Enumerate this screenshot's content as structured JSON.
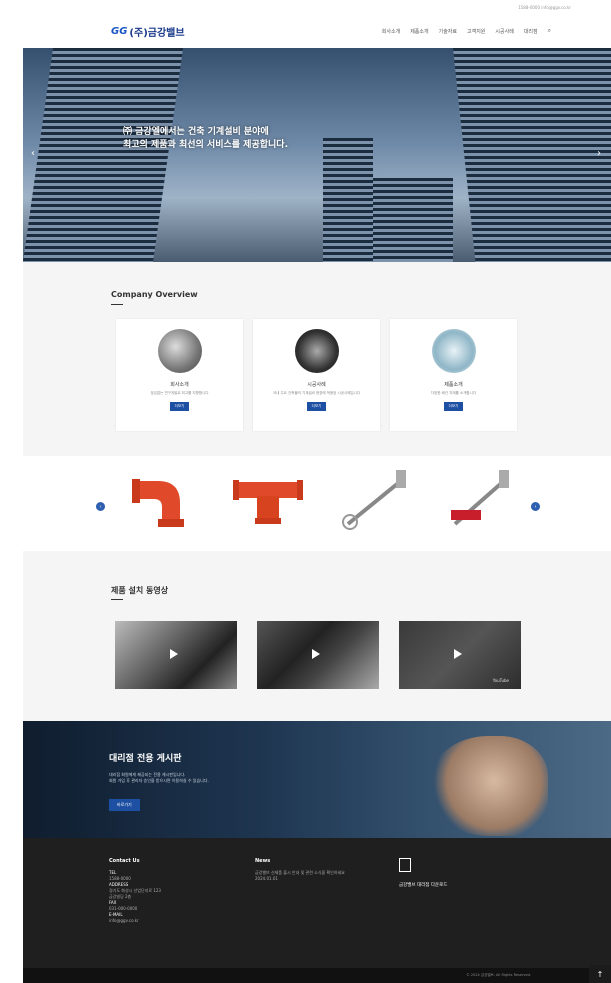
{
  "header": {
    "topbar_text": "1588-0000  info@ggv.co.kr",
    "logo_mark": "GG",
    "logo_text": "(주)금강밸브",
    "nav": [
      "회사소개",
      "제품소개",
      "기술자료",
      "고객지원",
      "시공사례",
      "대리점"
    ],
    "search_icon": "search-icon"
  },
  "hero": {
    "line1": "㈜ 금강엘에서는 건축 기계설비 분야에",
    "line2": "최고의 제품과 최선의 서비스를 제공합니다.",
    "prev": "‹",
    "next": "›"
  },
  "overview": {
    "title": "Company Overview",
    "cards": [
      {
        "title": "회사소개",
        "desc": "끊임없는 연구개발로 최고를 지향합니다",
        "button": "더보기"
      },
      {
        "title": "시공사례",
        "desc": "국내 주요 건축물의 기계설비 현장에 적용된 시공사례입니다",
        "button": "더보기"
      },
      {
        "title": "제품소개",
        "desc": "다양한 배관 자재를 소개합니다",
        "button": "더보기"
      }
    ]
  },
  "products": {
    "prev": "‹",
    "next": "›"
  },
  "videos": {
    "title": "제품 설치 동영상",
    "items": [
      {
        "label": ""
      },
      {
        "label": ""
      },
      {
        "label": "YouTube"
      }
    ]
  },
  "agency": {
    "title": "대리점 전용 게시판",
    "desc1": "대리점 회원에게 제공되는 전용 게시판입니다.",
    "desc2": "회원 가입 후 관리자 승인을 받으시면 이용하실 수 있습니다.",
    "button": "바로가기"
  },
  "footer": {
    "contact_title": "Contact Us",
    "contact_lines": [
      "TEL",
      "1588-0000",
      "ADDRESS",
      "경기도 화성시 산업단지로 123",
      "금강빌딩 2층",
      "FAX",
      "031-000-0000",
      "E-MAIL",
      "info@ggv.co.kr"
    ],
    "news_title": "News",
    "news_line": "금강밸브 신제품 출시 안내 및 관련 소식을 확인하세요",
    "news_date": "2024.01.01",
    "app_label": "금강밸브 대리점 다운로드",
    "copyright": "© 2024 금강밸브. All Rights Reserved.",
    "totop": "↑"
  }
}
